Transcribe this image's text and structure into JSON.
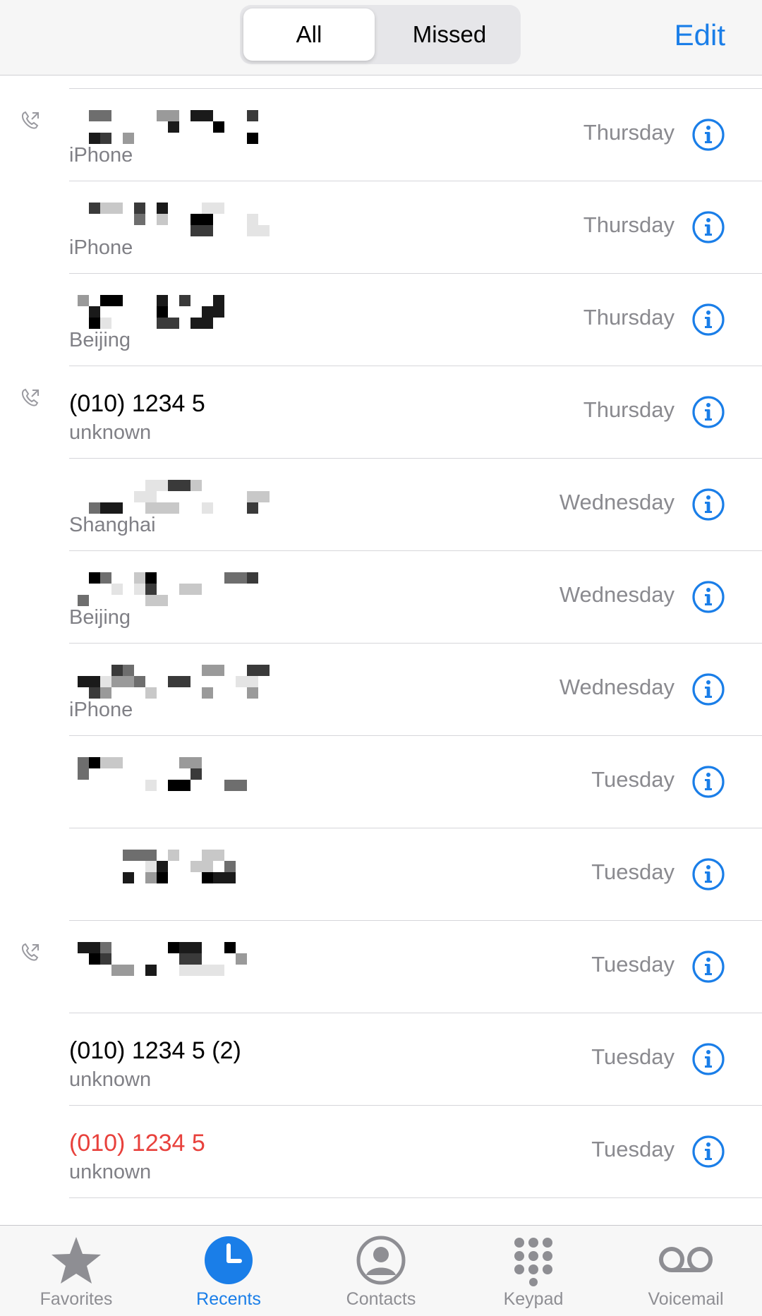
{
  "nav": {
    "segments": [
      "All",
      "Missed"
    ],
    "selected_segment": "All",
    "edit_label": "Edit"
  },
  "recents": [
    {
      "primary": "",
      "secondary": "iPhone",
      "day": "Thursday",
      "outgoing": true,
      "missed": false,
      "redacted": true
    },
    {
      "primary": "",
      "secondary": "iPhone",
      "day": "Thursday",
      "outgoing": false,
      "missed": false,
      "redacted": true
    },
    {
      "primary": "",
      "secondary": "Beijing",
      "day": "Thursday",
      "outgoing": false,
      "missed": false,
      "redacted": true
    },
    {
      "primary": "(010) 1234 5",
      "secondary": "unknown",
      "day": "Thursday",
      "outgoing": true,
      "missed": false,
      "redacted": false
    },
    {
      "primary": "",
      "secondary": "Shanghai",
      "day": "Wednesday",
      "outgoing": false,
      "missed": false,
      "redacted": true
    },
    {
      "primary": "",
      "secondary": "Beijing",
      "day": "Wednesday",
      "outgoing": false,
      "missed": false,
      "redacted": true
    },
    {
      "primary": "",
      "secondary": "iPhone",
      "day": "Wednesday",
      "outgoing": false,
      "missed": false,
      "redacted": true
    },
    {
      "primary": "",
      "secondary": "",
      "day": "Tuesday",
      "outgoing": false,
      "missed": false,
      "redacted": true
    },
    {
      "primary": "",
      "secondary": "",
      "day": "Tuesday",
      "outgoing": false,
      "missed": false,
      "redacted": true
    },
    {
      "primary": "",
      "secondary": "",
      "day": "Tuesday",
      "outgoing": true,
      "missed": false,
      "redacted": true
    },
    {
      "primary": "(010) 1234 5 (2)",
      "secondary": "unknown",
      "day": "Tuesday",
      "outgoing": false,
      "missed": false,
      "redacted": false
    },
    {
      "primary": "(010) 1234 5",
      "secondary": "unknown",
      "day": "Tuesday",
      "outgoing": false,
      "missed": true,
      "redacted": false
    }
  ],
  "tabs": [
    {
      "label": "Favorites",
      "icon": "star-icon",
      "active": false
    },
    {
      "label": "Recents",
      "icon": "clock-icon",
      "active": true
    },
    {
      "label": "Contacts",
      "icon": "person-circle-icon",
      "active": false
    },
    {
      "label": "Keypad",
      "icon": "keypad-icon",
      "active": false
    },
    {
      "label": "Voicemail",
      "icon": "voicemail-icon",
      "active": false
    }
  ],
  "colors": {
    "accent": "#1a7ee8",
    "missed": "#e8413c",
    "secondary_text": "#808086",
    "inactive_tab": "#8e8e93"
  }
}
